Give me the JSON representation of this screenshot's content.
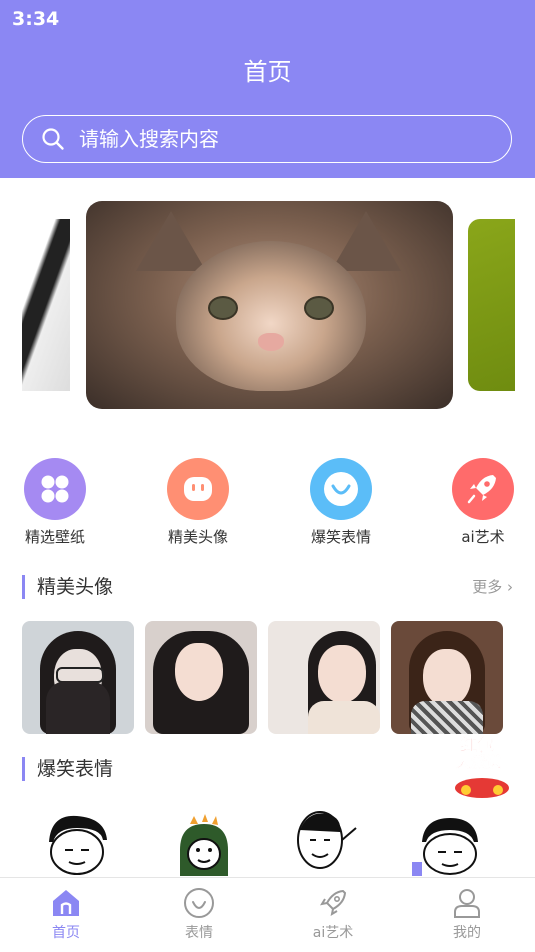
{
  "status_bar": {
    "time": "3:34"
  },
  "header": {
    "title": "首页"
  },
  "search": {
    "placeholder": "请输入搜索内容"
  },
  "categories": [
    {
      "label": "精选壁纸",
      "icon": "flower-icon",
      "color": "#a58af2"
    },
    {
      "label": "精美头像",
      "icon": "face-icon",
      "color": "#ff8f73"
    },
    {
      "label": "爆笑表情",
      "icon": "smile-icon",
      "color": "#5bbdf8"
    },
    {
      "label": "ai艺术",
      "icon": "rocket-icon",
      "color": "#ff6b6b"
    }
  ],
  "sections": {
    "avatars": {
      "title": "精美头像",
      "more": "更多"
    },
    "emojis": {
      "title": "爆笑表情"
    }
  },
  "red_packet": {
    "line1": "红包",
    "line2": "天派送"
  },
  "tabbar": [
    {
      "label": "首页",
      "icon": "home-icon",
      "active": true
    },
    {
      "label": "表情",
      "icon": "emoji-icon",
      "active": false
    },
    {
      "label": "ai艺术",
      "icon": "rocket-icon",
      "active": false
    },
    {
      "label": "我的",
      "icon": "user-icon",
      "active": false
    }
  ],
  "colors": {
    "primary": "#8b87f3",
    "accent_red": "#e53935"
  }
}
